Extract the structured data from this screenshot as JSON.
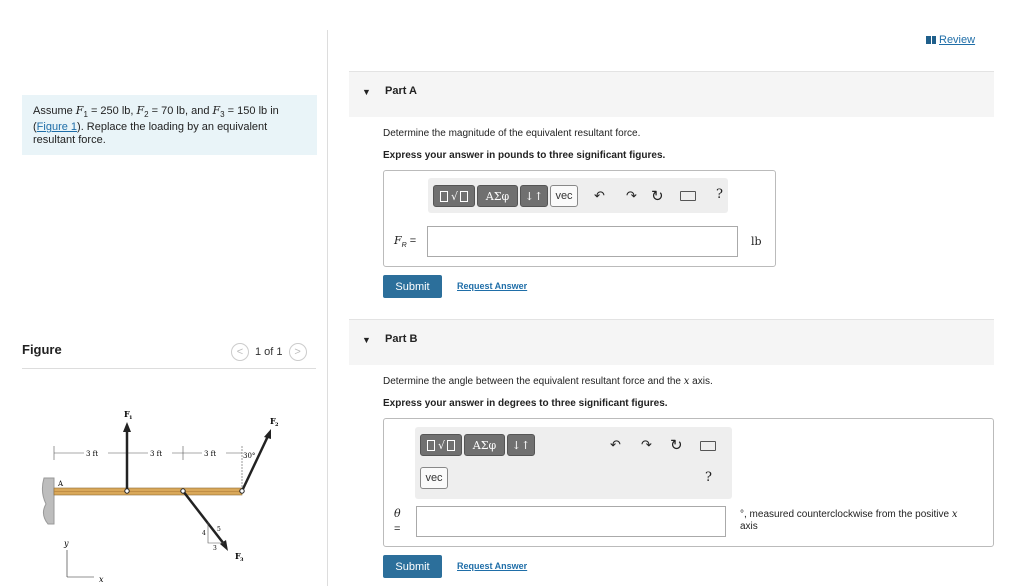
{
  "problem": {
    "t1": "Assume ",
    "f1": "F",
    "f1sub": "1",
    "f1val": " = 250 lb, ",
    "f2": "F",
    "f2sub": "2",
    "f2val": " = 70 lb, and ",
    "f3": "F",
    "f3sub": "3",
    "f3val": " = 150 lb in",
    "link": "Figure 1",
    "t2": "(",
    "t3": "). Replace the loading by an equivalent resultant force."
  },
  "figure": {
    "title": "Figure",
    "pager": "1 of 1",
    "prev": "<",
    "next": ">",
    "labels": {
      "F1": "F",
      "F1sub": "1",
      "F2": "F",
      "F2sub": "2",
      "F3": "F",
      "F3sub": "3",
      "d1": "3 ft",
      "d2": "3 ft",
      "d3": "3 ft",
      "angle": "30°",
      "A": "A",
      "five": "5",
      "four": "4",
      "three": "3",
      "y": "y",
      "x": "x"
    }
  },
  "review": "Review",
  "partA": {
    "title": "Part A",
    "question": "Determine the magnitude of the equivalent resultant force.",
    "instruction": "Express your answer in pounds to three significant figures.",
    "var": "F",
    "varsub": "R",
    "eq": " =",
    "unit": "lb",
    "tb_greek": "ΑΣφ",
    "tb_arrows": "↓↑",
    "tb_vec": "vec",
    "tb_help": "?",
    "submit": "Submit",
    "request": "Request Answer"
  },
  "partB": {
    "title": "Part B",
    "question1": "Determine the angle between the equivalent resultant force and the ",
    "question_x": "x",
    "question2": " axis.",
    "instruction": "Express your answer in degrees to three significant figures.",
    "var": "θ",
    "eq": "=",
    "unit1": "°, measured counterclockwise from the positive ",
    "unit_x": "x",
    "unit2": "axis",
    "tb_greek": "ΑΣφ",
    "tb_arrows": "↓↑",
    "tb_vec": "vec",
    "tb_help": "?",
    "submit": "Submit",
    "request": "Request Answer"
  },
  "colors": {
    "accent": "#2c6f9b",
    "link": "#1f6ea8",
    "problem_bg": "#e9f4f8",
    "beam": "#d9a85a"
  }
}
